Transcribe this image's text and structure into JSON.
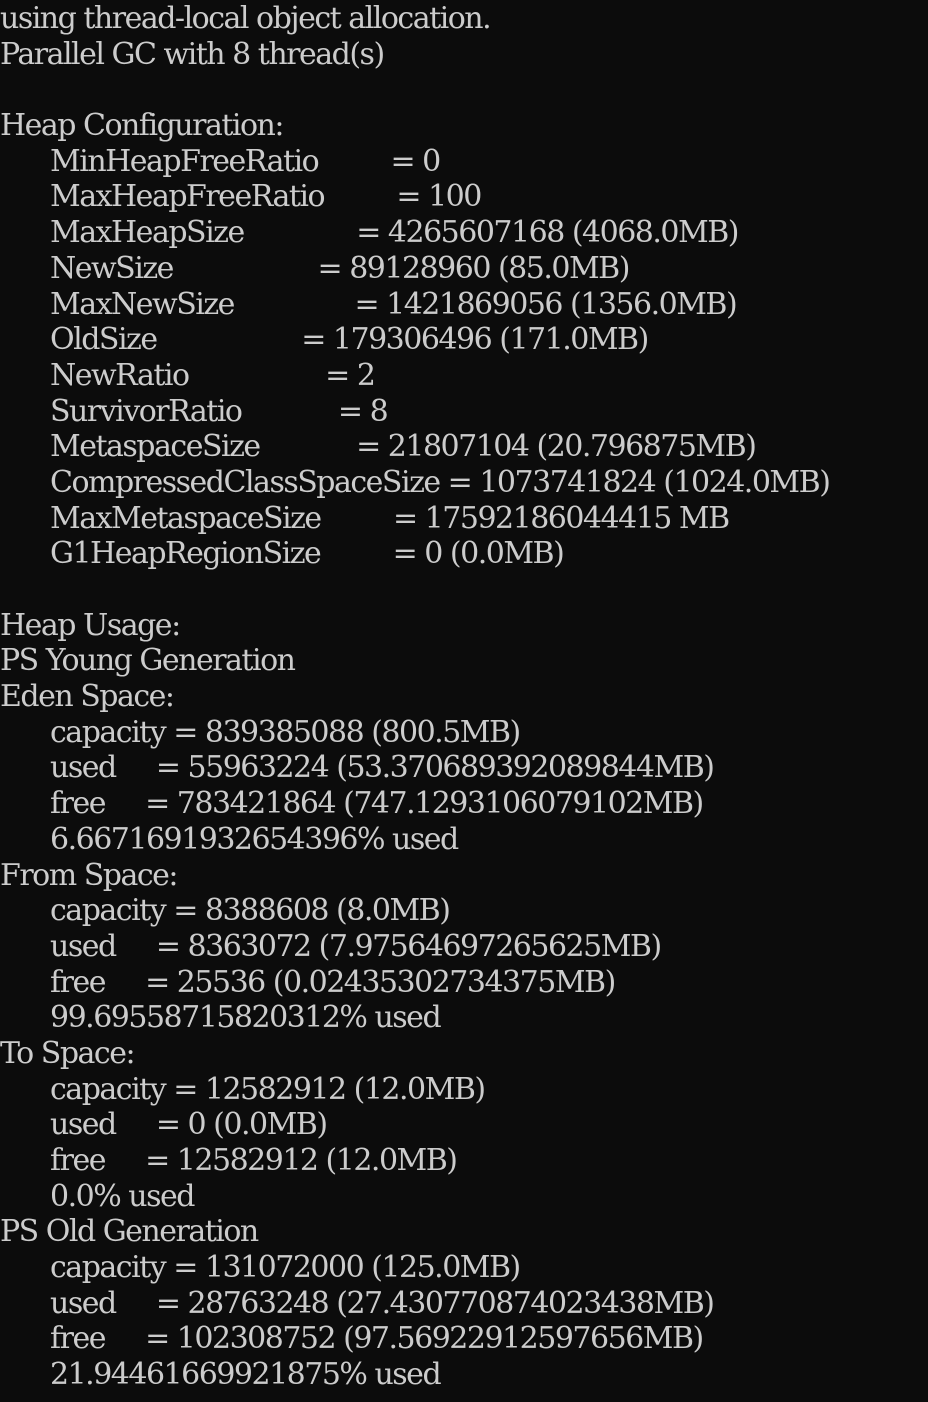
{
  "colors": {
    "background": "#0c0c0c",
    "foreground": "#cccccc"
  },
  "lines": [
    {
      "text": "using thread-local object allocation.",
      "indent": false
    },
    {
      "text": "Parallel GC with 8 thread(s)",
      "indent": false
    },
    {
      "text": "",
      "indent": false
    },
    {
      "text": "Heap Configuration:",
      "indent": false
    },
    {
      "text": "MinHeapFreeRatio         = 0",
      "indent": true
    },
    {
      "text": "MaxHeapFreeRatio         = 100",
      "indent": true
    },
    {
      "text": "MaxHeapSize              = 4265607168 (4068.0MB)",
      "indent": true
    },
    {
      "text": "NewSize                  = 89128960 (85.0MB)",
      "indent": true
    },
    {
      "text": "MaxNewSize               = 1421869056 (1356.0MB)",
      "indent": true
    },
    {
      "text": "OldSize                  = 179306496 (171.0MB)",
      "indent": true
    },
    {
      "text": "NewRatio                 = 2",
      "indent": true
    },
    {
      "text": "SurvivorRatio            = 8",
      "indent": true
    },
    {
      "text": "MetaspaceSize            = 21807104 (20.796875MB)",
      "indent": true
    },
    {
      "text": "CompressedClassSpaceSize = 1073741824 (1024.0MB)",
      "indent": true
    },
    {
      "text": "MaxMetaspaceSize         = 17592186044415 MB",
      "indent": true
    },
    {
      "text": "G1HeapRegionSize         = 0 (0.0MB)",
      "indent": true
    },
    {
      "text": "",
      "indent": false
    },
    {
      "text": "Heap Usage:",
      "indent": false
    },
    {
      "text": "PS Young Generation",
      "indent": false
    },
    {
      "text": "Eden Space:",
      "indent": false
    },
    {
      "text": "capacity = 839385088 (800.5MB)",
      "indent": true
    },
    {
      "text": "used     = 55963224 (53.370689392089844MB)",
      "indent": true
    },
    {
      "text": "free     = 783421864 (747.1293106079102MB)",
      "indent": true
    },
    {
      "text": "6.6671691932654396% used",
      "indent": true
    },
    {
      "text": "From Space:",
      "indent": false
    },
    {
      "text": "capacity = 8388608 (8.0MB)",
      "indent": true
    },
    {
      "text": "used     = 8363072 (7.97564697265625MB)",
      "indent": true
    },
    {
      "text": "free     = 25536 (0.02435302734375MB)",
      "indent": true
    },
    {
      "text": "99.69558715820312% used",
      "indent": true
    },
    {
      "text": "To Space:",
      "indent": false
    },
    {
      "text": "capacity = 12582912 (12.0MB)",
      "indent": true
    },
    {
      "text": "used     = 0 (0.0MB)",
      "indent": true
    },
    {
      "text": "free     = 12582912 (12.0MB)",
      "indent": true
    },
    {
      "text": "0.0% used",
      "indent": true
    },
    {
      "text": "PS Old Generation",
      "indent": false
    },
    {
      "text": "capacity = 131072000 (125.0MB)",
      "indent": true
    },
    {
      "text": "used     = 28763248 (27.430770874023438MB)",
      "indent": true
    },
    {
      "text": "free     = 102308752 (97.56922912597656MB)",
      "indent": true
    },
    {
      "text": "21.94461669921875% used",
      "indent": true
    }
  ]
}
